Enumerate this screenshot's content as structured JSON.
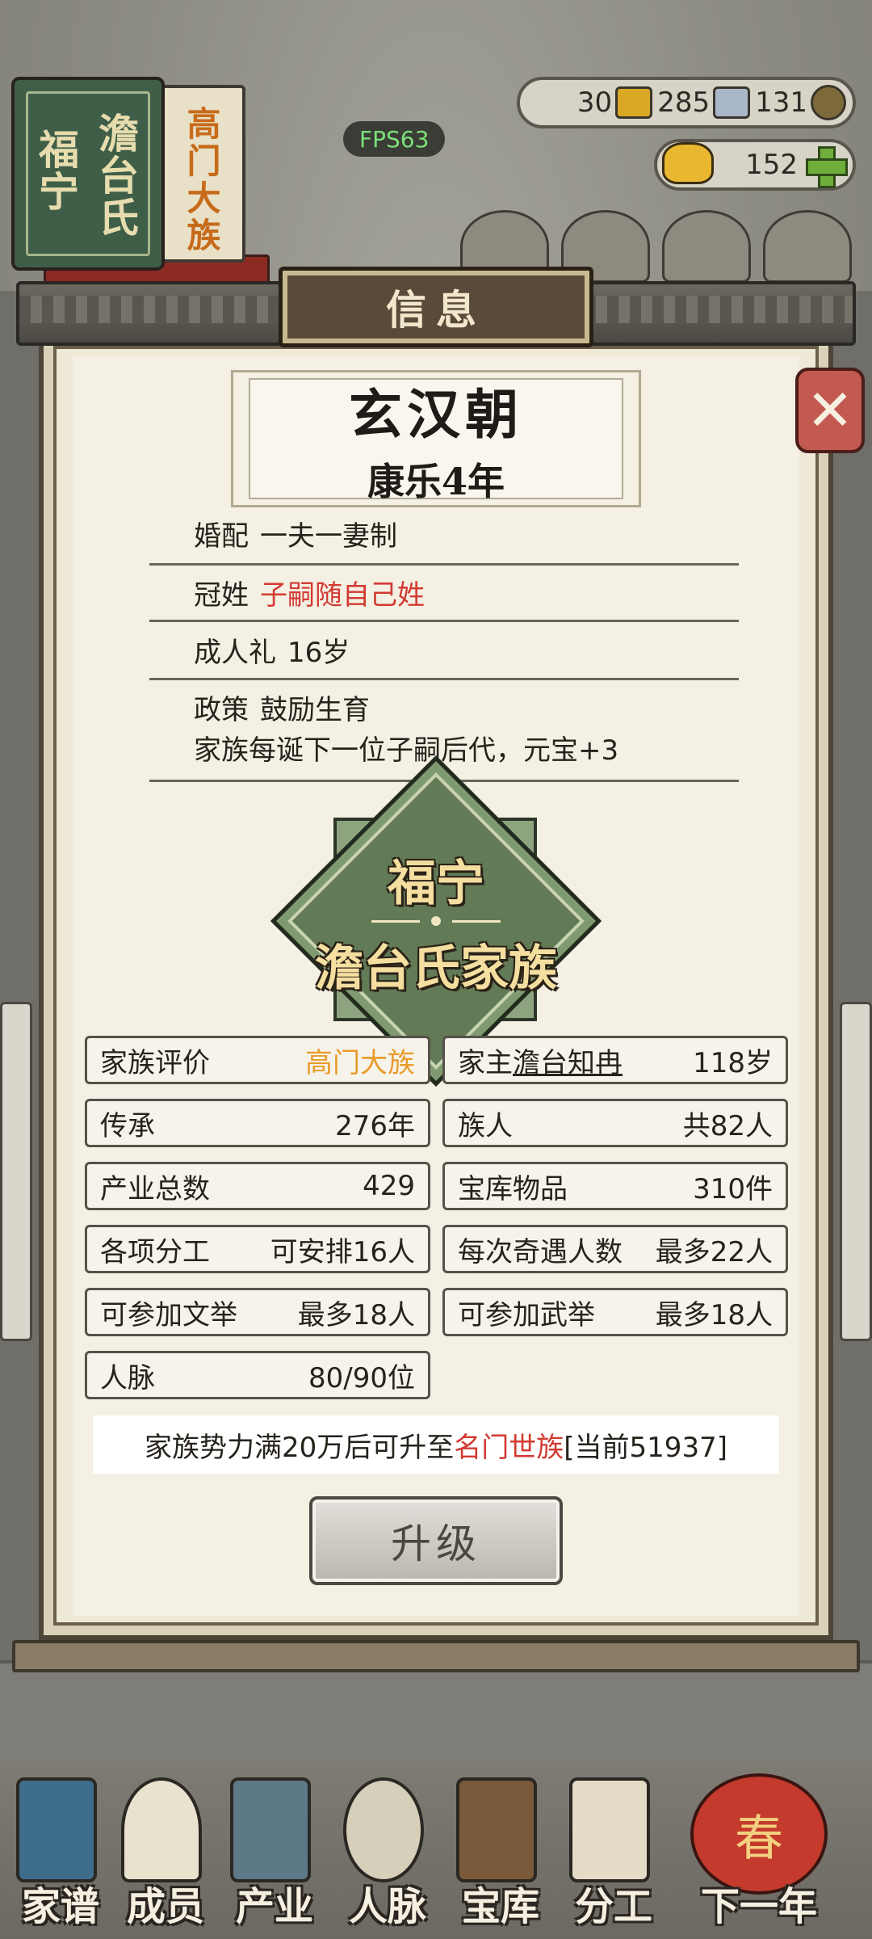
{
  "hud": {
    "clan_book": {
      "title": "福宁",
      "clan": "澹台氏",
      "rank": "高门大族"
    },
    "resources": {
      "gold_bars": "30",
      "silver": "285",
      "coins": "131",
      "yuanbao": "152"
    },
    "fps": "FPS63"
  },
  "modal": {
    "title": "信息",
    "era": {
      "dynasty": "玄汉朝",
      "year": "康乐4年"
    },
    "rules": [
      {
        "label": "婚配",
        "value": "一夫一妻制"
      },
      {
        "label": "冠姓",
        "value": "子嗣随自己姓"
      },
      {
        "label": "成人礼",
        "value": "16岁"
      },
      {
        "label": "政策",
        "value": "鼓励生育",
        "note": "家族每诞下一位子嗣后代，元宝+3"
      }
    ],
    "emblem": {
      "line1": "福宁",
      "line2": "澹台氏家族"
    },
    "stats": {
      "rating": {
        "label": "家族评价",
        "value": "高门大族"
      },
      "head": {
        "label": "家主",
        "name": "澹台知冉",
        "value": "118岁"
      },
      "heritage": {
        "label": "传承",
        "value": "276年"
      },
      "members": {
        "label": "族人",
        "value": "共82人"
      },
      "industry": {
        "label": "产业总数",
        "value": "429"
      },
      "vault": {
        "label": "宝库物品",
        "value": "310件"
      },
      "labor": {
        "label": "各项分工",
        "value": "可安排16人"
      },
      "encounter": {
        "label": "每次奇遇人数",
        "value": "最多22人"
      },
      "civil_exam": {
        "label": "可参加文举",
        "value": "最多18人"
      },
      "military_exam": {
        "label": "可参加武举",
        "value": "最多18人"
      },
      "network": {
        "label": "人脉",
        "value": "80/90位"
      }
    },
    "notice": {
      "prefix": "家族势力满20万后可升至",
      "target": "名门世族",
      "suffix": "[当前51937]"
    },
    "upgrade_label": "升级"
  },
  "bottom_nav": [
    {
      "label": "家谱"
    },
    {
      "label": "成员"
    },
    {
      "label": "产业"
    },
    {
      "label": "人脉"
    },
    {
      "label": "宝库"
    },
    {
      "label": "分工"
    },
    {
      "label": "下一年"
    }
  ],
  "lantern_char": "春",
  "colors": {
    "accent_red": "#d23a32",
    "accent_orange": "#e89b2b",
    "emblem_green": "#627a56",
    "close_red": "#c35a52"
  },
  "icons": [
    "gold-bar-icon",
    "silver-icon",
    "coin-icon",
    "yuanbao-icon",
    "plus-icon",
    "close-icon"
  ]
}
